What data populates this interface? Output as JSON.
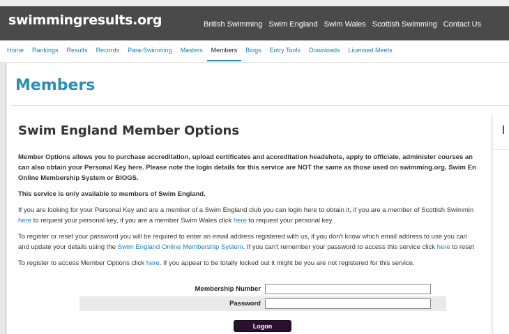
{
  "site": {
    "logo": "swimmingresults.org"
  },
  "top_nav": [
    "British Swimming",
    "Swim England",
    "Swim Wales",
    "Scottish Swimming",
    "Contact Us"
  ],
  "main_nav": {
    "items": [
      "Home",
      "Rankings",
      "Results",
      "Records",
      "Para-Swimming",
      "Masters",
      "Members",
      "Biogs",
      "Entry Tools",
      "Downloads",
      "Licensed Meets"
    ],
    "active": "Members"
  },
  "page": {
    "title": "Members",
    "section_title": "Swim England Member Options"
  },
  "content": {
    "p1_line1": "Member Options allows you to purchase accreditation, upload certificates and accreditation headshots, apply to officiate, administer courses an",
    "p1_line2": "can also obtain your Personal Key here. Please note the login details for this service are NOT the same as those used on swimming.org, Swim En",
    "p1_line3": "Online Membership System or BIOGS.",
    "p2": "This service is only available to members of Swim England.",
    "p3_line1": "If you are looking for your Personal Key and are a member of a Swim England club you can login here to obtain it, if you are a member of Scottish Swimmin",
    "p3_link_here_a": "here",
    "p3_line2_mid": " to request your personal key, if you are a member Swim Wales click ",
    "p3_link_here_b": "here",
    "p3_line2_end": " to request your personal key.",
    "p4_line1": "To register or reset your password you will be required to enter an email address registered with us, if you don't know which email address to use you can",
    "p4_line2_start": "and update your details using the ",
    "p4_link_oms": "Swim England Online Membership System",
    "p4_line2_mid": ". If you can't remember your password to access this service click ",
    "p4_link_here": "here",
    "p4_line2_end": " to reset",
    "p5_start": "To register to access Member Options click ",
    "p5_link_here": "here",
    "p5_end": ". If you appear to be totally locked out it might be you are not registered for this service."
  },
  "login": {
    "membership_label": "Membership Number",
    "membership_value": "",
    "password_label": "Password",
    "password_value": "",
    "logon_label": "Logon"
  },
  "colors": {
    "header_bg": "#4a4a4a",
    "accent": "#2a8fb0",
    "link": "#1a7fb5",
    "button": "#2b1030"
  }
}
